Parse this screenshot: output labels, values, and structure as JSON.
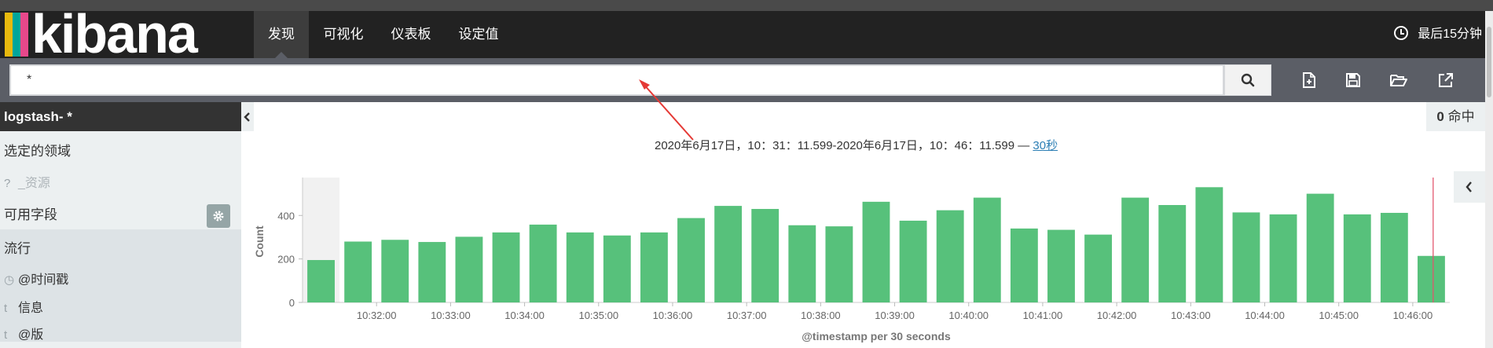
{
  "app": {
    "logo_text": "kibana",
    "logo_colors": [
      "#E8B90E",
      "#00A69B",
      "#E8488B"
    ]
  },
  "nav": {
    "tabs": [
      {
        "label": "发现",
        "active": true
      },
      {
        "label": "可视化",
        "active": false
      },
      {
        "label": "仪表板",
        "active": false
      },
      {
        "label": "设定值",
        "active": false
      }
    ],
    "time_label": "最后15分钟"
  },
  "search": {
    "value": "*",
    "icons": [
      "search-icon",
      "new-search-icon",
      "save-icon",
      "open-icon",
      "share-icon"
    ]
  },
  "sidebar": {
    "index_pattern": "logstash- *",
    "selected_fields_label": "选定的领域",
    "selected_fields": [
      {
        "type_symbol": "?",
        "name": "_资源"
      }
    ],
    "available_fields_label": "可用字段",
    "popular_label": "流行",
    "popular_fields": [
      {
        "type_symbol": "◷",
        "name": "@时间戳"
      },
      {
        "type_symbol": "t",
        "name": "信息"
      }
    ],
    "other_fields": [
      {
        "type_symbol": "t",
        "name": "@版"
      }
    ]
  },
  "hits": {
    "count": "0",
    "label": "命中"
  },
  "time_range": {
    "text": "2020年6月17日，10：31：11.599-2020年6月17日，10：46：11.599 —",
    "interval_link": "30秒"
  },
  "colors": {
    "bar": "#57c17b",
    "navbar": "#222222",
    "searchbar": "#5b5e66",
    "marker": "#e2556d"
  },
  "chart_data": {
    "type": "bar",
    "xlabel": "@timestamp per 30 seconds",
    "ylabel": "Count",
    "ylim": [
      0,
      560
    ],
    "yticks": [
      0,
      200,
      400
    ],
    "x_tick_labels": [
      "10:32:00",
      "10:33:00",
      "10:34:00",
      "10:35:00",
      "10:36:00",
      "10:37:00",
      "10:38:00",
      "10:39:00",
      "10:40:00",
      "10:41:00",
      "10:42:00",
      "10:43:00",
      "10:44:00",
      "10:45:00",
      "10:46:00"
    ],
    "categories": [
      "10:31:00",
      "10:31:30",
      "10:32:00",
      "10:32:30",
      "10:33:00",
      "10:33:30",
      "10:34:00",
      "10:34:30",
      "10:35:00",
      "10:35:30",
      "10:36:00",
      "10:36:30",
      "10:37:00",
      "10:37:30",
      "10:38:00",
      "10:38:30",
      "10:39:00",
      "10:39:30",
      "10:40:00",
      "10:40:30",
      "10:41:00",
      "10:41:30",
      "10:42:00",
      "10:42:30",
      "10:43:00",
      "10:43:30",
      "10:44:00",
      "10:44:30",
      "10:45:00",
      "10:45:30",
      "10:46:00"
    ],
    "values": [
      195,
      280,
      288,
      278,
      302,
      322,
      358,
      322,
      308,
      322,
      388,
      444,
      430,
      355,
      350,
      463,
      376,
      424,
      482,
      340,
      334,
      312,
      482,
      448,
      530,
      414,
      405,
      500,
      405,
      412,
      214
    ],
    "grid": false
  }
}
